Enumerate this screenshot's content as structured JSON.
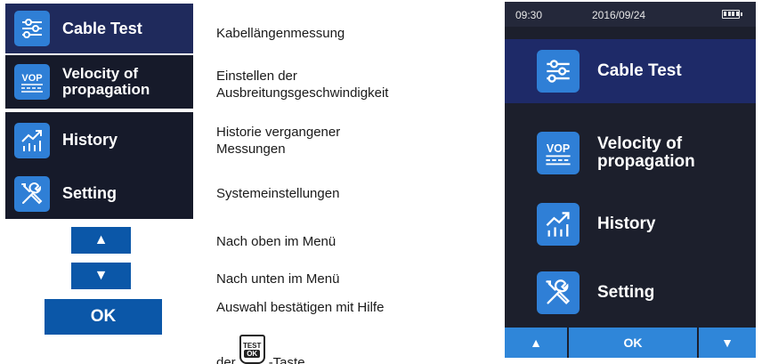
{
  "menu": {
    "items": [
      {
        "label": "Cable Test",
        "icon": "sliders-icon"
      },
      {
        "label": "Velocity of propagation",
        "line1": "Velocity of",
        "line2": "propagation",
        "icon": "vop-icon"
      },
      {
        "label": "History",
        "icon": "chart-up-icon"
      },
      {
        "label": "Setting",
        "icon": "tools-icon"
      }
    ]
  },
  "buttons": {
    "up": "▲",
    "down": "▼",
    "ok": "OK"
  },
  "descriptions": {
    "cable": "Kabellängenmessung",
    "vop_line1": "Einstellen der",
    "vop_line2": "Ausbreitungsgeschwindigkeit",
    "history_line1": "Historie vergangener",
    "history_line2": "Messungen",
    "setting": "Systemeinstellungen",
    "up": "Nach oben im Menü",
    "down": "Nach unten im Menü",
    "ok_line1": "Auswahl bestätigen mit Hilfe",
    "ok_der": "der",
    "ok_taste": "-Taste",
    "test_key_top": "TEST",
    "test_key_bottom": "OK"
  },
  "device": {
    "time": "09:30",
    "date": "2016/09/24",
    "items": [
      {
        "label": "Cable Test",
        "icon": "sliders-icon"
      },
      {
        "line1": "Velocity of",
        "line2": "propagation",
        "icon": "vop-icon"
      },
      {
        "label": "History",
        "icon": "chart-up-icon"
      },
      {
        "label": "Setting",
        "icon": "tools-icon"
      }
    ],
    "bar": {
      "up": "▲",
      "ok": "OK",
      "down": "▼"
    }
  },
  "colors": {
    "accent": "#2f7fd6",
    "selected_row": "#1f2a5c",
    "panel": "#161a2a",
    "button": "#0b57a8"
  }
}
